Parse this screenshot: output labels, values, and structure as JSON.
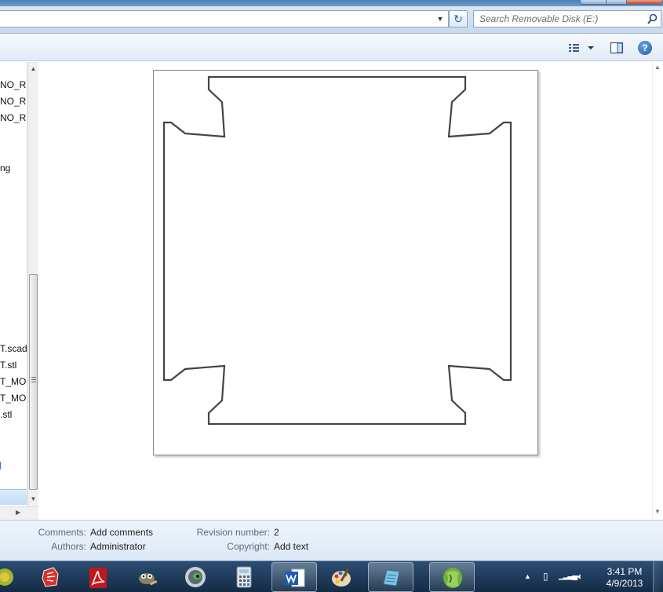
{
  "address_bar": {
    "search_placeholder": "Search Removable Disk (E:)"
  },
  "nav_pane": {
    "items": [
      {
        "label": "NO_RE"
      },
      {
        "label": "NO_RE"
      },
      {
        "label": "NO_RE"
      },
      {
        "label": "ng"
      },
      {
        "label": "T.scad"
      },
      {
        "label": "T.stl"
      },
      {
        "label": "T_MO"
      },
      {
        "label": "T_MO"
      },
      {
        "label": ".stl"
      }
    ]
  },
  "details": {
    "comments_label": "Comments:",
    "comments_value": "Add comments",
    "authors_label": "Authors:",
    "authors_value": "Administrator",
    "revision_label": "Revision number:",
    "revision_value": "2",
    "copyright_label": "Copyright:",
    "copyright_value": "Add text"
  },
  "taskbar": {
    "apps": [
      {
        "icon": "app-icon-partial"
      },
      {
        "icon": "sketchup-icon"
      },
      {
        "icon": "acrobat-icon"
      },
      {
        "icon": "gimp-icon"
      },
      {
        "icon": "media-player-icon"
      },
      {
        "icon": "calculator-icon"
      },
      {
        "icon": "word-icon",
        "active": true
      },
      {
        "icon": "paint-icon"
      },
      {
        "icon": "notepad-icon",
        "active": true
      },
      {
        "icon": "corel-icon",
        "active": true
      }
    ],
    "clock_time": "3:41 PM",
    "clock_date": "4/9/2013"
  },
  "colors": {
    "taskbar_bg": "#1c3657",
    "details_bg": "#e6eef8",
    "selection": "#cde4fb"
  }
}
